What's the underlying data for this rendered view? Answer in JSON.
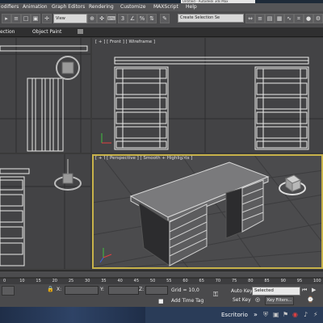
{
  "title": {
    "text": "Untitled - Autodesk 3ds Max"
  },
  "menu": {
    "items": [
      "odifiers",
      "Animation",
      "Graph Editors",
      "Rendering",
      "Customize",
      "MAXScript",
      "Help"
    ]
  },
  "toolbar": {
    "view_dropdown": "View",
    "selection_set": "Create Selection Se"
  },
  "ribbon": {
    "tab_left": "ection",
    "tab_object_paint": "Object Paint"
  },
  "viewports": {
    "front_label": "[ + ] [ Front ] [ Wireframe ]",
    "perspective_label": "[ + ] [ Perspective ] [ Smooth + Highlights ]"
  },
  "timeline": {
    "ticks": [
      "0",
      "10",
      "15",
      "20",
      "25",
      "30",
      "35",
      "40",
      "45",
      "50",
      "55",
      "60",
      "65",
      "70",
      "75",
      "80",
      "85",
      "90",
      "95",
      "100"
    ]
  },
  "status": {
    "x_label": "X:",
    "y_label": "Y:",
    "z_label": "Z:",
    "grid": "Grid = 10,0",
    "add_time_tag": "Add Time Tag",
    "auto_key": "Auto Key",
    "selected": "Selected",
    "set_key": "Set Key",
    "key_filters": "Key Filters..."
  },
  "taskbar": {
    "desktop_label": "Escritorio"
  },
  "colors": {
    "viewport_bg": "#434345",
    "active_viewport_border": "#c7b24a",
    "taskbar": "#2a3c58"
  }
}
